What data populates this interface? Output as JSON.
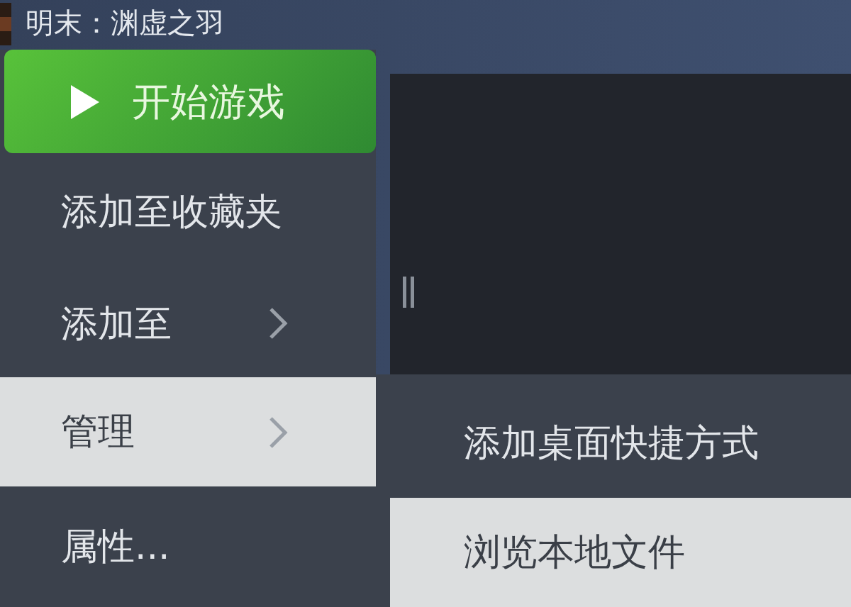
{
  "window": {
    "title": "明末：渊虚之羽"
  },
  "menu": {
    "items": [
      {
        "label": "开始游戏",
        "kind": "play",
        "selected": false
      },
      {
        "label": "添加至收藏夹",
        "kind": "action",
        "selected": false
      },
      {
        "label": "添加至",
        "kind": "submenu",
        "selected": false
      },
      {
        "label": "管理",
        "kind": "submenu",
        "selected": true
      },
      {
        "label": "属性...",
        "kind": "action",
        "selected": false
      }
    ]
  },
  "submenu": {
    "items": [
      {
        "label": "添加桌面快捷方式",
        "selected": false
      },
      {
        "label": "浏览本地文件",
        "selected": true
      }
    ]
  }
}
